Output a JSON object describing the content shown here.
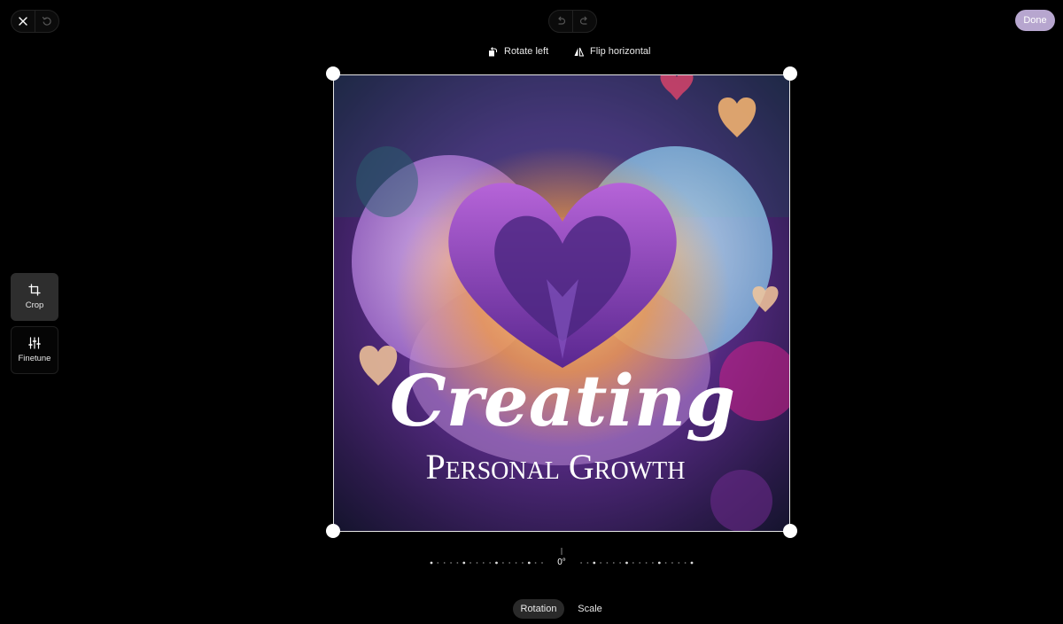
{
  "toolbar": {
    "done_label": "Done",
    "rotate_left_label": "Rotate left",
    "flip_horizontal_label": "Flip horizontal"
  },
  "sidebar": {
    "tools": [
      {
        "label": "Crop",
        "icon": "crop-icon",
        "active": true
      },
      {
        "label": "Finetune",
        "icon": "sliders-icon",
        "active": false
      }
    ]
  },
  "image": {
    "title_script": "Creating",
    "subtitle": "Personal Growth"
  },
  "rotation": {
    "readout": "0°"
  },
  "bottom_tabs": [
    {
      "label": "Rotation",
      "active": true
    },
    {
      "label": "Scale",
      "active": false
    }
  ],
  "colors": {
    "done_button": "#b7a6cf",
    "active_tool_bg": "#2e2e2e",
    "active_tab_bg": "#2a2a2a"
  }
}
